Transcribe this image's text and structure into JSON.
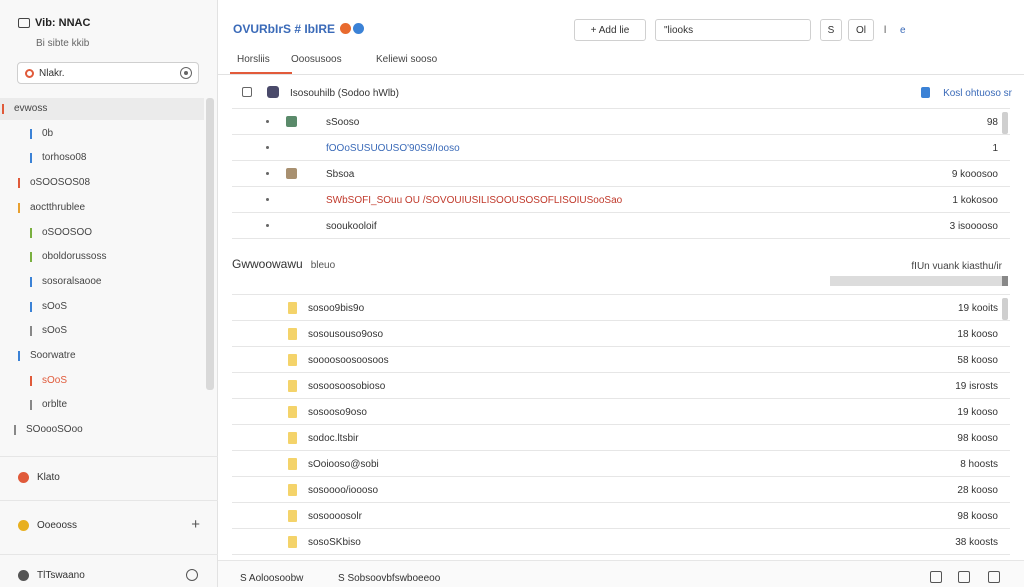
{
  "app": {
    "title": "Vib: NNAC",
    "subtitle": "Bi sibte kkib"
  },
  "sidebar": {
    "search_value": "Nlakr.",
    "tree": [
      {
        "label": "evwoss",
        "indent": 14,
        "active": true,
        "icon_color": "#e05a3a"
      },
      {
        "label": "0b",
        "indent": 42,
        "icon_color": "#3b82d6"
      },
      {
        "label": "torhoso08",
        "indent": 42,
        "icon_color": "#3b82d6"
      },
      {
        "label": "oSOOSOS08",
        "indent": 30,
        "icon_color": "#e05a3a"
      },
      {
        "label": "aoctthrublee",
        "indent": 30,
        "icon_color": "#e8a030"
      },
      {
        "label": "oSOOSOO",
        "indent": 42,
        "icon_color": "#7ab040"
      },
      {
        "label": "oboldorussoss",
        "indent": 42,
        "icon_color": "#7ab040"
      },
      {
        "label": "sosoralsaooe",
        "indent": 42,
        "icon_color": "#3b82d6"
      },
      {
        "label": "sOoS",
        "indent": 42,
        "icon_color": "#3b82d6"
      },
      {
        "label": "sOoS",
        "indent": 42,
        "icon_color": "#888888"
      },
      {
        "label": "Soorwatre",
        "indent": 30,
        "icon_color": "#3b82d6"
      },
      {
        "label": "sOoS",
        "indent": 42,
        "icon_color": "#e05a3a",
        "text_color": "#e05a3a"
      },
      {
        "label": "orblte",
        "indent": 42,
        "icon_color": "#888888"
      },
      {
        "label": "SOoooSOoo",
        "indent": 26,
        "icon_color": "#888888"
      }
    ],
    "sections": [
      {
        "label": "Klato",
        "color": "#e05a3a"
      },
      {
        "label": "Ooeooss",
        "color": "#e8b020"
      },
      {
        "label": "TlTswaano",
        "color": "#555555"
      }
    ]
  },
  "toolbar": {
    "breadcrumb": "OVURbIrS # IbIRE",
    "add_button": "Add lie",
    "search_value": "\"liooks",
    "btn_s": "S",
    "btn_ol": "Ol",
    "sep_text": "l",
    "extra_text": "e"
  },
  "tabs": [
    {
      "label": "Horsliis"
    },
    {
      "label": "Ooosusoos"
    },
    {
      "label": "Keliewi sooso"
    }
  ],
  "section1": {
    "header": "Isosouhilb (Sodoo hWlb)",
    "right_label": "Kosl ohtuoso sr",
    "rows": [
      {
        "name": "sSooso",
        "size": "98",
        "icon_color": "#5a8a6a",
        "name_color": "#333333"
      },
      {
        "name": "fOOoSUSUOUSO'90S9/Iooso",
        "size": "1",
        "icon_color": "",
        "name_color": "#3a6ab8"
      },
      {
        "name": "Sbsoa",
        "size": "9 kooosoo",
        "icon_color": "#a89070",
        "name_color": "#333333"
      },
      {
        "name": "SWbSOFI_SOuu OU /SOVOUIUSILISOOUSOSOFLISOIUSooSao",
        "size": "1 kokosoo",
        "icon_color": "",
        "name_color": "#c0392b"
      },
      {
        "name": "sooukooloif",
        "size": "3 isooooso",
        "icon_color": "",
        "name_color": "#333333"
      }
    ]
  },
  "section2": {
    "title": "Gwwoowawu",
    "subtitle": "bleuo",
    "right_label": "fIUn vuank kiasthu/ir",
    "rows": [
      {
        "name": "sosoo9bis9o",
        "size": "19 kooits"
      },
      {
        "name": "sosousouso9oso",
        "size": "18 kooso"
      },
      {
        "name": "soooosoosoosoos",
        "size": "58 kooso"
      },
      {
        "name": "sosoosoosobioso",
        "size": "19 isrosts"
      },
      {
        "name": "sosooso9oso",
        "size": "19 kooso"
      },
      {
        "name": "sodoc.ltsbir",
        "size": "98 kooso"
      },
      {
        "name": "sOoiooso@sobi",
        "size": "8 hoosts"
      },
      {
        "name": "sosoooo/ioooso",
        "size": "28 kooso"
      },
      {
        "name": "sosoooosolr",
        "size": "98 kooso"
      },
      {
        "name": "sosoSKbiso",
        "size": "38 koosts"
      }
    ]
  },
  "footer": {
    "left": "S  Aoloosoobw",
    "mid": "S  Sobsoovbfswboeeoo"
  }
}
